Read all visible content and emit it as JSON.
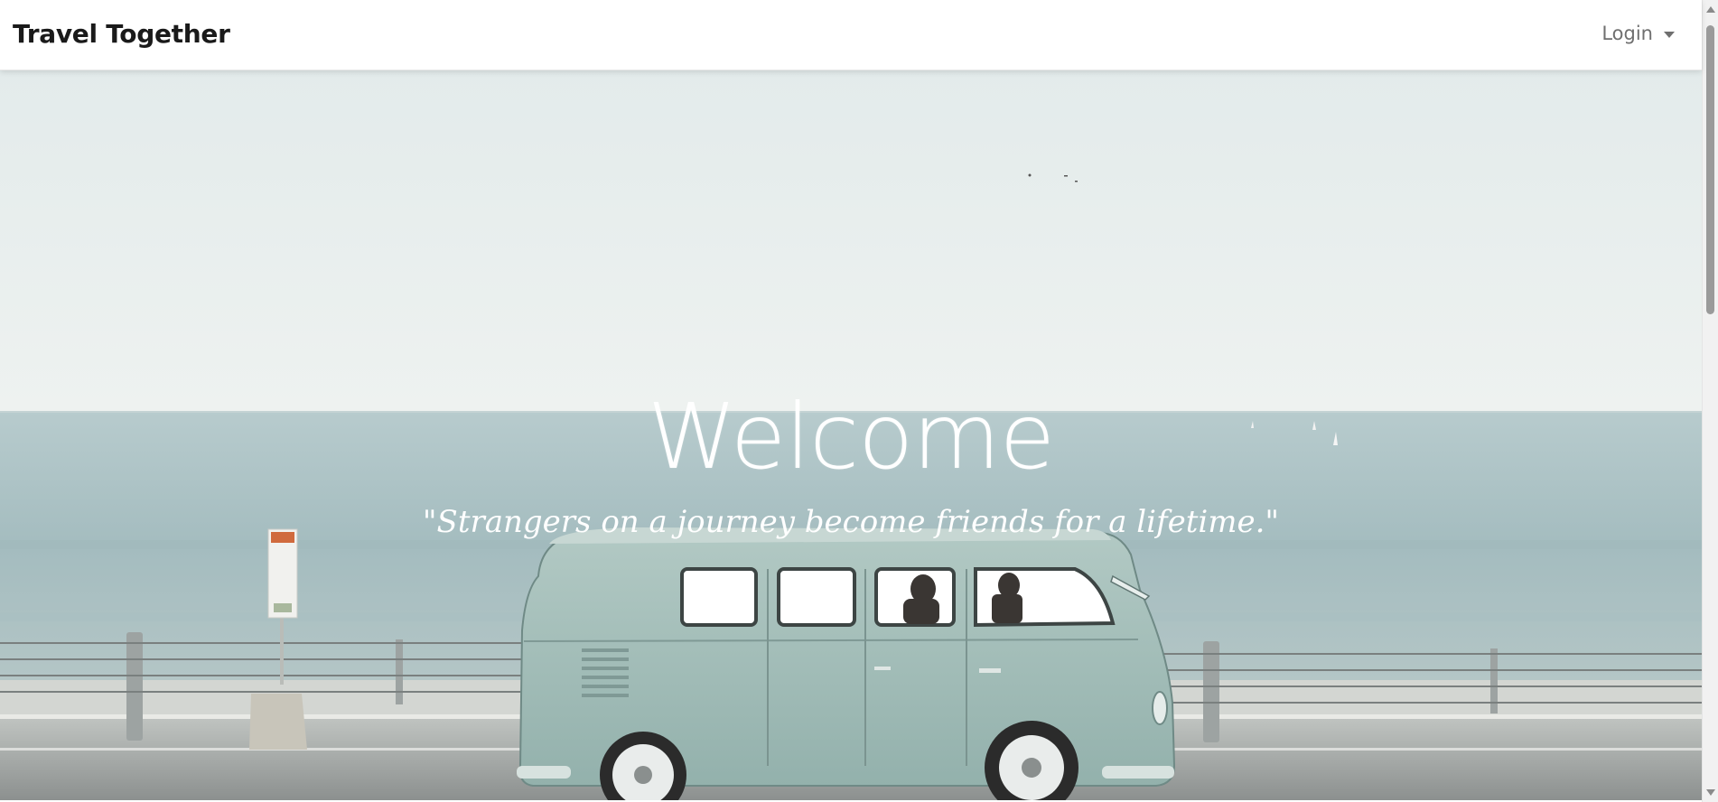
{
  "navbar": {
    "brand": "Travel Together",
    "login_label": "Login"
  },
  "hero": {
    "title": "Welcome",
    "quote": "\"Strangers on a journey become friends for a lifetime.\""
  },
  "colors": {
    "sky": "#e8eeee",
    "sea": "#a9c2c6",
    "van": "#9cbab5",
    "road": "#8f9393",
    "text_on_hero": "#ffffff"
  },
  "icons": {
    "login_caret": "chevron-down-icon",
    "scroll_up": "scroll-up-arrow-icon",
    "scroll_down": "scroll-down-arrow-icon"
  }
}
